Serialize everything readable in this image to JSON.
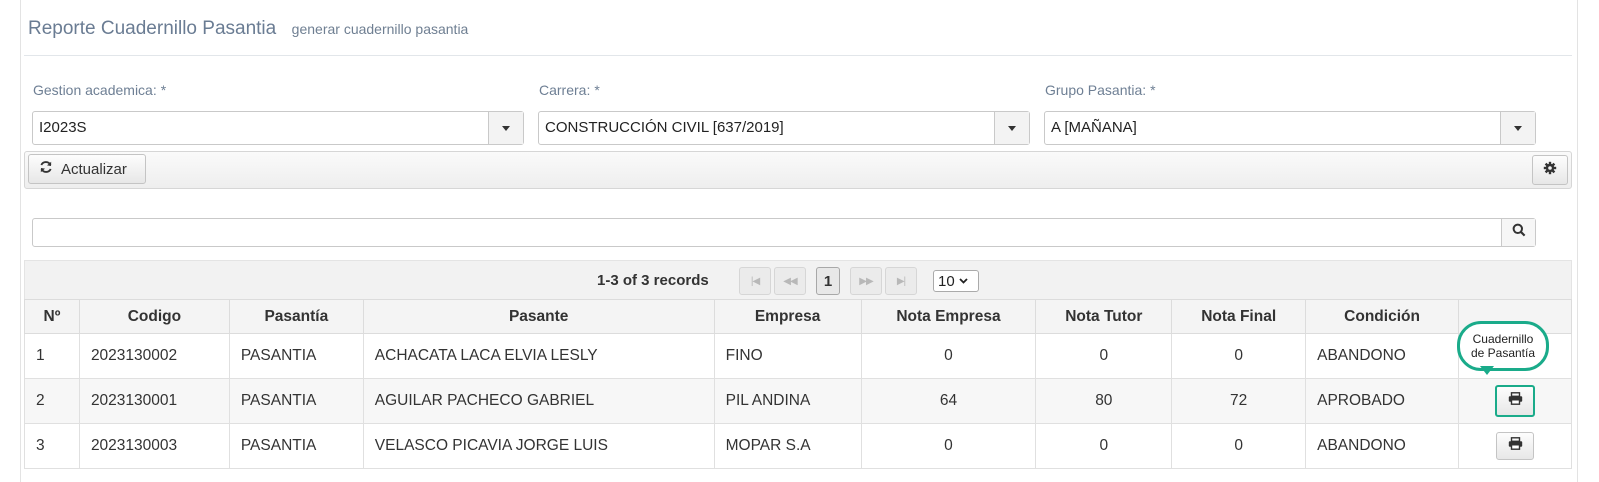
{
  "header": {
    "title": "Reporte Cuadernillo Pasantia",
    "subtitle": "generar cuadernillo pasantia"
  },
  "filters": {
    "gestion": {
      "label": "Gestion academica:",
      "required": "*",
      "value": "I2023S"
    },
    "carrera": {
      "label": "Carrera:",
      "required": "*",
      "value": "CONSTRUCCIÓN CIVIL [637/2019]"
    },
    "grupo": {
      "label": "Grupo Pasantia:",
      "required": "*",
      "value": "A [MAÑANA]"
    }
  },
  "toolbar": {
    "refresh_label": "Actualizar"
  },
  "search": {
    "value": ""
  },
  "pager": {
    "records": "1-3 of 3 records",
    "current_page": "1",
    "page_size": "10"
  },
  "table": {
    "columns": [
      "Nº",
      "Codigo",
      "Pasantía",
      "Pasante",
      "Empresa",
      "Nota Empresa",
      "Nota Tutor",
      "Nota Final",
      "Condición",
      ""
    ],
    "rows": [
      {
        "n": "1",
        "codigo": "2023130002",
        "pasantia": "PASANTIA",
        "pasante": "ACHACATA LACA ELVIA LESLY",
        "empresa": "FINO",
        "nota_empresa": "0",
        "nota_tutor": "0",
        "nota_final": "0",
        "condicion": "ABANDONO"
      },
      {
        "n": "2",
        "codigo": "2023130001",
        "pasantia": "PASANTIA",
        "pasante": "AGUILAR PACHECO GABRIEL",
        "empresa": "PIL ANDINA",
        "nota_empresa": "64",
        "nota_tutor": "80",
        "nota_final": "72",
        "condicion": "APROBADO"
      },
      {
        "n": "3",
        "codigo": "2023130003",
        "pasantia": "PASANTIA",
        "pasante": "VELASCO PICAVIA JORGE LUIS",
        "empresa": "MOPAR S.A",
        "nota_empresa": "0",
        "nota_tutor": "0",
        "nota_final": "0",
        "condicion": "ABANDONO"
      }
    ]
  },
  "tooltip": {
    "line1": "Cuadernillo",
    "line2": "de Pasantía"
  },
  "colors": {
    "accent": "#1aab8a",
    "title": "#6a7c93"
  },
  "icons": [
    "refresh-icon",
    "gear-icon",
    "search-icon",
    "caret-down-icon",
    "print-icon",
    "first-page-icon",
    "prev-page-icon",
    "next-page-icon",
    "last-page-icon"
  ]
}
